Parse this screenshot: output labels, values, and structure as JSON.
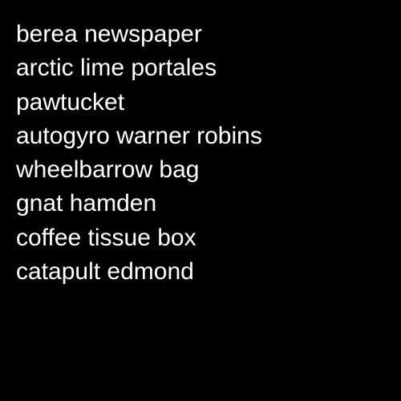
{
  "lines": [
    "berea newspaper",
    "arctic lime portales",
    "pawtucket",
    "autogyro warner robins",
    "wheelbarrow bag",
    "gnat hamden",
    "coffee tissue box",
    "catapult edmond"
  ],
  "colors": {
    "background": "#000000",
    "text": "#ffffff"
  }
}
